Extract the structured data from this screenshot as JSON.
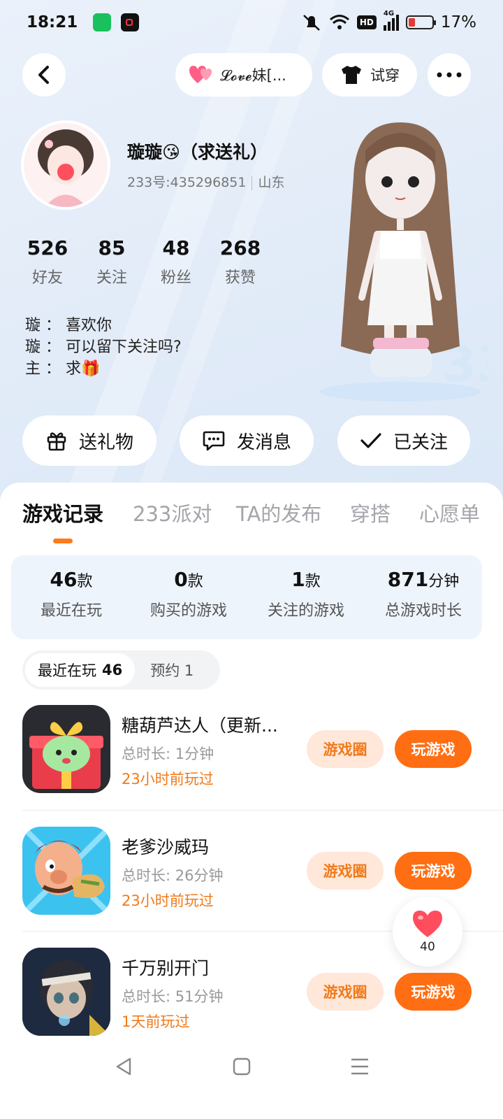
{
  "status_bar": {
    "time": "18:21",
    "network": "4G",
    "hd": "HD",
    "battery": "17%",
    "battery_level": 0.17,
    "icons": [
      "iqiyi-app-icon",
      "recorder-app-icon",
      "mute-icon",
      "wifi-icon",
      "hd-icon",
      "signal-icon",
      "battery-icon"
    ]
  },
  "top_bar": {
    "back_icon": "chevron-left-icon",
    "pair_label": "𝓛𝓸𝓿𝓮妹[...",
    "try_on_label": "试穿",
    "more_icon": "more-dots-icon"
  },
  "profile": {
    "name": "璇璇😘（求送礼）",
    "id_text": "233号:435296851",
    "region": "山东",
    "stats": [
      {
        "num": "526",
        "label": "好友"
      },
      {
        "num": "85",
        "label": "关注"
      },
      {
        "num": "48",
        "label": "粉丝"
      },
      {
        "num": "268",
        "label": "获赞"
      }
    ],
    "bio": [
      "璇 ：  喜欢你",
      "璇 ： 可以留下关注吗?",
      "主 ： 求🎁"
    ]
  },
  "actions": {
    "gift": "送礼物",
    "message": "发消息",
    "followed": "已关注"
  },
  "tabs": [
    "游戏记录",
    "233派对",
    "TA的发布",
    "穿搭",
    "心愿单"
  ],
  "active_tab": "游戏记录",
  "summary": [
    {
      "value": "46",
      "unit": "款",
      "label": "最近在玩"
    },
    {
      "value": "0",
      "unit": "款",
      "label": "购买的游戏"
    },
    {
      "value": "1",
      "unit": "款",
      "label": "关注的游戏"
    },
    {
      "value": "871",
      "unit": "分钟",
      "label": "总游戏时长"
    }
  ],
  "segment": {
    "recent_label": "最近在玩",
    "recent_count": "46",
    "reserve_label": "预约 1"
  },
  "games": [
    {
      "title": "糖葫芦达人（更新...",
      "duration": "总时长:  1分钟",
      "last_played": "23小时前玩过",
      "circle": "游戏圈",
      "play": "玩游戏"
    },
    {
      "title": "老爹沙威玛",
      "duration": "总时长:  26分钟",
      "last_played": "23小时前玩过",
      "circle": "游戏圈",
      "play": "玩游戏"
    },
    {
      "title": "千万别开门",
      "duration": "总时长:  51分钟",
      "last_played": "1天前玩过",
      "circle": "游戏圈",
      "play": "玩游戏"
    }
  ],
  "like_float": {
    "count": "40"
  },
  "colors": {
    "accent": "#ff6e12",
    "accent_text": "#f07a1a",
    "accent_soft": "#ffe7d9",
    "hero_bg": "#e3ecf8",
    "summary_bg": "#eef4fc"
  }
}
